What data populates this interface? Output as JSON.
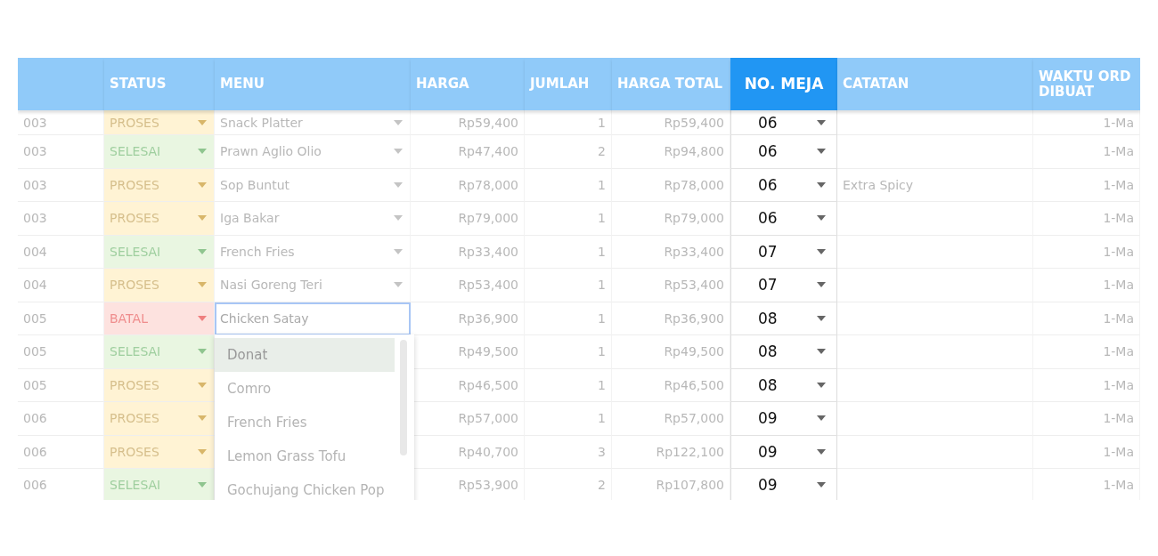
{
  "columns": [
    {
      "highlighted": false
    },
    {
      "label": "STATUS",
      "highlighted": false
    },
    {
      "label": "MENU",
      "highlighted": false
    },
    {
      "label": "HARGA",
      "highlighted": false
    },
    {
      "label": "JUMLAH",
      "highlighted": false
    },
    {
      "label": "HARGA TOTAL",
      "highlighted": false
    },
    {
      "label": "NO. MEJA",
      "highlighted": true
    },
    {
      "label": "CATATAN",
      "highlighted": false
    },
    {
      "label": "WAKTU ORD\nDIBUAT",
      "highlighted": false
    }
  ],
  "rows": [
    {
      "id": "003",
      "status": {
        "label": "PROSES",
        "kind": "proses"
      },
      "menu": "Snack Platter",
      "editing": false,
      "harga": "Rp59,400",
      "jumlah": "1",
      "total": "Rp59,400",
      "meja": "06",
      "waktu": "1-Ma"
    },
    {
      "id": "003",
      "status": {
        "label": "SELESAI",
        "kind": "selesai"
      },
      "menu": "Prawn Aglio Olio",
      "editing": false,
      "harga": "Rp47,400",
      "jumlah": "2",
      "total": "Rp94,800",
      "meja": "06",
      "waktu": "1-Ma"
    },
    {
      "id": "003",
      "status": {
        "label": "PROSES",
        "kind": "proses"
      },
      "menu": "Sop Buntut",
      "editing": false,
      "harga": "Rp78,000",
      "jumlah": "1",
      "total": "Rp78,000",
      "meja": "06",
      "catatan": "Extra Spicy",
      "waktu": "1-Ma"
    },
    {
      "id": "003",
      "status": {
        "label": "PROSES",
        "kind": "proses"
      },
      "menu": "Iga Bakar",
      "editing": false,
      "harga": "Rp79,000",
      "jumlah": "1",
      "total": "Rp79,000",
      "meja": "06",
      "waktu": "1-Ma"
    },
    {
      "id": "004",
      "status": {
        "label": "SELESAI",
        "kind": "selesai"
      },
      "menu": "French Fries",
      "editing": false,
      "harga": "Rp33,400",
      "jumlah": "1",
      "total": "Rp33,400",
      "meja": "07",
      "waktu": "1-Ma"
    },
    {
      "id": "004",
      "status": {
        "label": "PROSES",
        "kind": "proses"
      },
      "menu": "Nasi Goreng Teri",
      "editing": false,
      "harga": "Rp53,400",
      "jumlah": "1",
      "total": "Rp53,400",
      "meja": "07",
      "waktu": "1-Ma"
    },
    {
      "id": "005",
      "status": {
        "label": "BATAL",
        "kind": "batal"
      },
      "menu": "Chicken Satay",
      "editing": true,
      "harga": "Rp36,900",
      "jumlah": "1",
      "total": "Rp36,900",
      "meja": "08",
      "waktu": "1-Ma"
    },
    {
      "id": "005",
      "status": {
        "label": "SELESAI",
        "kind": "selesai"
      },
      "harga": "Rp49,500",
      "jumlah": "1",
      "total": "Rp49,500",
      "meja": "08",
      "waktu": "1-Ma"
    },
    {
      "id": "005",
      "status": {
        "label": "PROSES",
        "kind": "proses"
      },
      "harga": "Rp46,500",
      "jumlah": "1",
      "total": "Rp46,500",
      "meja": "08",
      "waktu": "1-Ma"
    },
    {
      "id": "006",
      "status": {
        "label": "PROSES",
        "kind": "proses"
      },
      "harga": "Rp57,000",
      "jumlah": "1",
      "total": "Rp57,000",
      "meja": "09",
      "waktu": "1-Ma"
    },
    {
      "id": "006",
      "status": {
        "label": "PROSES",
        "kind": "proses"
      },
      "harga": "Rp40,700",
      "jumlah": "3",
      "total": "Rp122,100",
      "meja": "09",
      "waktu": "1-Ma"
    },
    {
      "id": "006",
      "status": {
        "label": "SELESAI",
        "kind": "selesai"
      },
      "harga": "Rp53,900",
      "jumlah": "2",
      "total": "Rp107,800",
      "meja": "09",
      "waktu": "1-Ma"
    }
  ],
  "menu_dropdown": {
    "options": [
      {
        "label": "Donat",
        "selected": true
      },
      {
        "label": "Comro",
        "selected": false
      },
      {
        "label": "French Fries",
        "selected": false
      },
      {
        "label": "Lemon Grass Tofu",
        "selected": false
      },
      {
        "label": "Gochujang Chicken Pop",
        "selected": false
      }
    ]
  }
}
